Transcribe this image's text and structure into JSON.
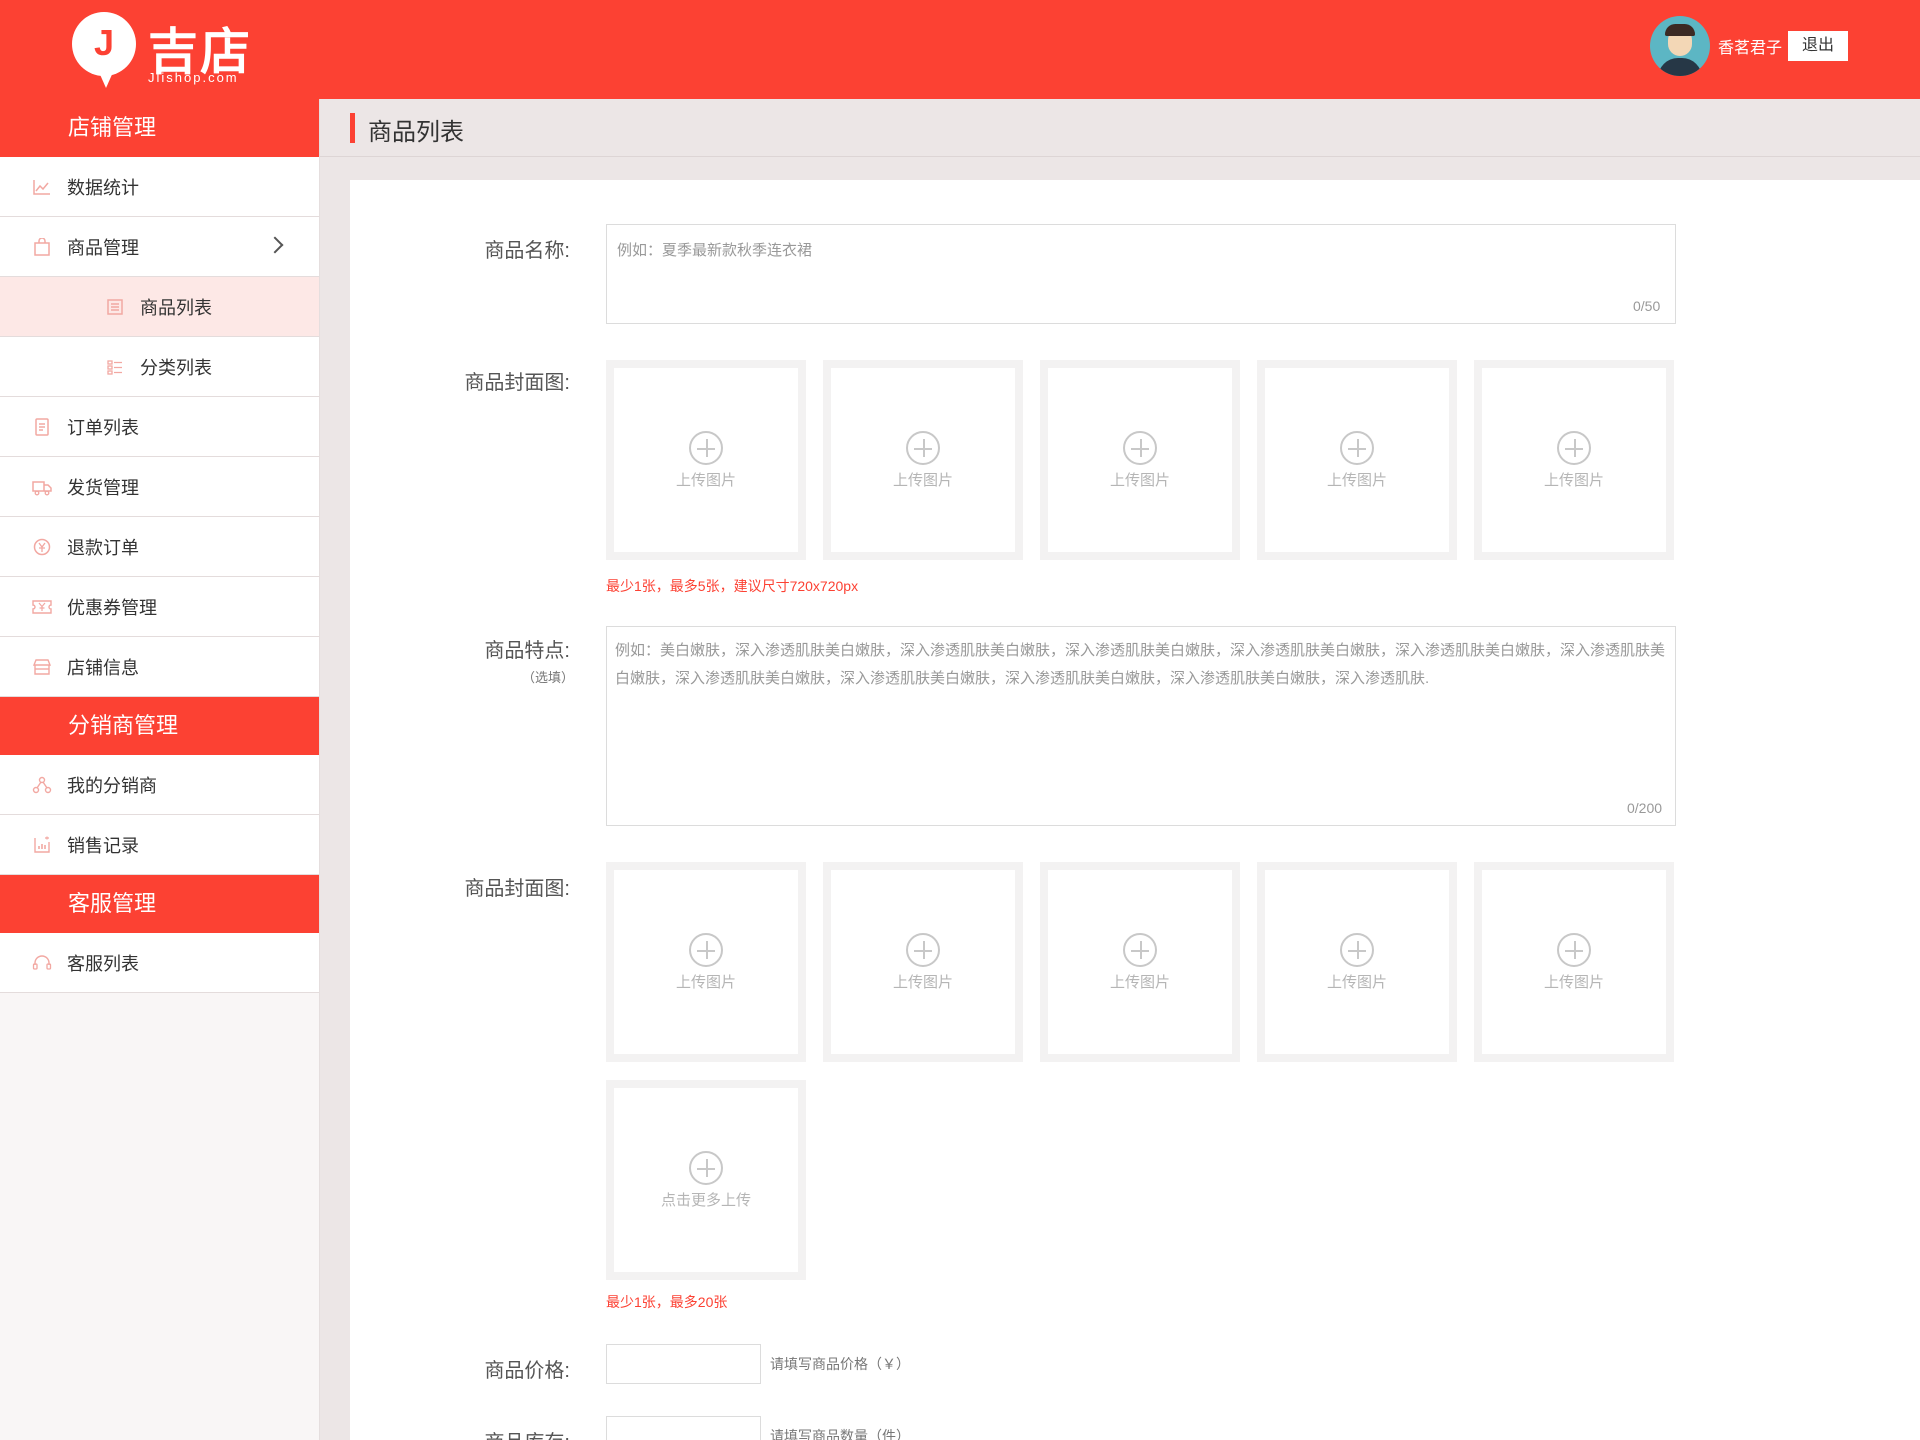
{
  "header": {
    "logo_mark": "J",
    "logo_name": "吉店",
    "logo_domain": "Jlishop.com",
    "username": "香茗君子",
    "logout_label": "退出"
  },
  "sidebar": {
    "sections": [
      {
        "title": "店铺管理",
        "items": [
          {
            "label": "数据统计",
            "icon": "chart-icon"
          },
          {
            "label": "商品管理",
            "icon": "bag-icon"
          },
          {
            "label": "商品列表",
            "icon": "list-icon"
          },
          {
            "label": "分类列表",
            "icon": "category-icon"
          },
          {
            "label": "订单列表",
            "icon": "order-icon"
          },
          {
            "label": "发货管理",
            "icon": "truck-icon"
          },
          {
            "label": "退款订单",
            "icon": "refund-icon"
          },
          {
            "label": "优惠券管理",
            "icon": "coupon-icon"
          },
          {
            "label": "店铺信息",
            "icon": "shop-icon"
          }
        ]
      },
      {
        "title": "分销商管理",
        "items": [
          {
            "label": "我的分销商",
            "icon": "network-icon"
          },
          {
            "label": "销售记录",
            "icon": "sales-icon"
          }
        ]
      },
      {
        "title": "客服管理",
        "items": [
          {
            "label": "客服列表",
            "icon": "headset-icon"
          }
        ]
      }
    ]
  },
  "main": {
    "title": "商品列表",
    "form": {
      "name_label": "商品名称:",
      "name_placeholder": "例如：夏季最新款秋季连衣裙",
      "name_counter": "0/50",
      "cover_label": "商品封面图:",
      "upload_label": "上传图片",
      "cover_hint": "最少1张，最多5张，建议尺寸720x720px",
      "feature_label": "商品特点:",
      "feature_optional": "（选填）",
      "feature_placeholder": "例如：美白嫩肤，深入渗透肌肤美白嫩肤，深入渗透肌肤美白嫩肤，深入渗透肌肤美白嫩肤，深入渗透肌肤美白嫩肤，深入渗透肌肤美白嫩肤，深入渗透肌肤美白嫩肤，深入渗透肌肤美白嫩肤，深入渗透肌肤美白嫩肤，深入渗透肌肤美白嫩肤，深入渗透肌肤美白嫩肤，深入渗透肌肤.",
      "feature_counter": "0/200",
      "gallery_label": "商品封面图:",
      "more_upload_label": "点击更多上传",
      "gallery_hint": "最少1张，最多20张",
      "price_label": "商品价格:",
      "price_hint": "请填写商品价格（￥）",
      "stock_label": "商品库存:",
      "stock_hint": "请填写商品数量（件）"
    }
  },
  "colors": {
    "brand": "#fc4133",
    "sidebar_bg": "#f9f6f6",
    "active_bg": "#fde8e6"
  }
}
